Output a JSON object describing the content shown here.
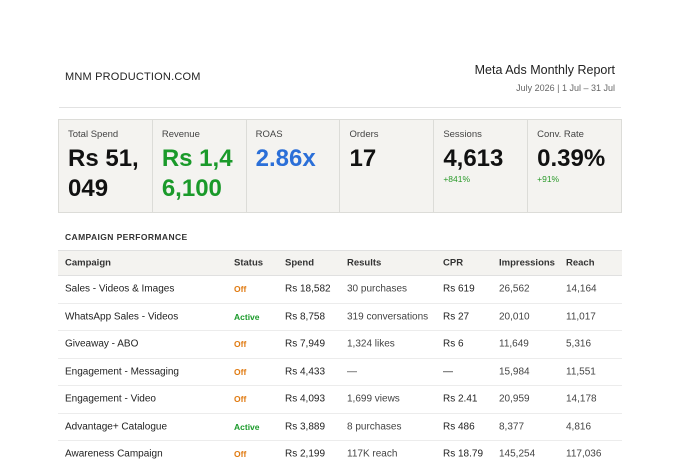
{
  "header": {
    "brand": "MNM PRODUCTION.COM",
    "title": "Meta Ads Monthly Report",
    "period": "July 2026  |  1 Jul – 31 Jul"
  },
  "kpis": [
    {
      "label": "Total Spend",
      "value": "Rs 51,049",
      "delta": "",
      "color": "#111111"
    },
    {
      "label": "Revenue",
      "value": "Rs 1,46,100",
      "delta": "",
      "color": "#1a9a2a"
    },
    {
      "label": "ROAS",
      "value": "2.86x",
      "delta": "",
      "color": "#2b6fd8"
    },
    {
      "label": "Orders",
      "value": "17",
      "delta": "",
      "color": "#111111"
    },
    {
      "label": "Sessions",
      "value": "4,613",
      "delta": "+841%",
      "color": "#111111"
    },
    {
      "label": "Conv. Rate",
      "value": "0.39%",
      "delta": "+91%",
      "color": "#111111"
    }
  ],
  "section_title": "CAMPAIGN PERFORMANCE",
  "table": {
    "columns": [
      "Campaign",
      "Status",
      "Spend",
      "Results",
      "CPR",
      "Impressions",
      "Reach"
    ],
    "rows": [
      {
        "campaign": "Sales - Videos & Images",
        "status": "Off",
        "spend": "Rs 18,582",
        "results": "30 purchases",
        "cpr": "Rs 619",
        "impressions": "26,562",
        "reach": "14,164"
      },
      {
        "campaign": "WhatsApp Sales - Videos",
        "status": "Active",
        "spend": "Rs 8,758",
        "results": "319 conversations",
        "cpr": "Rs 27",
        "impressions": "20,010",
        "reach": "11,017"
      },
      {
        "campaign": "Giveaway - ABO",
        "status": "Off",
        "spend": "Rs 7,949",
        "results": "1,324 likes",
        "cpr": "Rs 6",
        "impressions": "11,649",
        "reach": "5,316"
      },
      {
        "campaign": "Engagement - Messaging",
        "status": "Off",
        "spend": "Rs 4,433",
        "results": "—",
        "cpr": "—",
        "impressions": "15,984",
        "reach": "11,551"
      },
      {
        "campaign": "Engagement - Video",
        "status": "Off",
        "spend": "Rs 4,093",
        "results": "1,699 views",
        "cpr": "Rs 2.41",
        "impressions": "20,959",
        "reach": "14,178"
      },
      {
        "campaign": "Advantage+ Catalogue",
        "status": "Active",
        "spend": "Rs 3,889",
        "results": "8 purchases",
        "cpr": "Rs 486",
        "impressions": "8,377",
        "reach": "4,816"
      },
      {
        "campaign": "Awareness Campaign",
        "status": "Off",
        "spend": "Rs 2,199",
        "results": "117K reach",
        "cpr": "Rs 18.79",
        "impressions": "145,254",
        "reach": "117,036"
      }
    ]
  },
  "colors": {
    "status_off": "#e07a10",
    "status_active": "#1a9a2a",
    "kpi_bg": "#f4f3f0"
  }
}
